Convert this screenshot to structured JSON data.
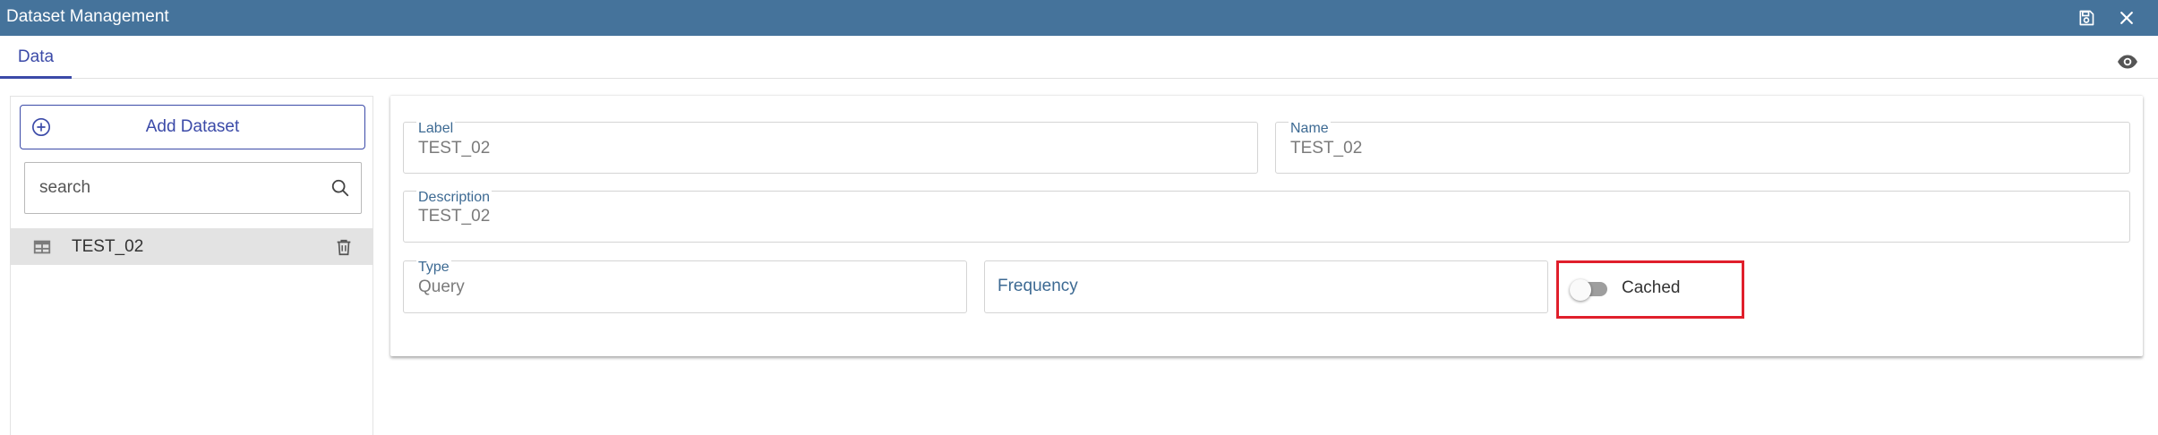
{
  "window": {
    "title": "Dataset Management",
    "save_icon": "floppy-disk-icon",
    "close_icon": "close-icon"
  },
  "tabs": [
    {
      "label": "Data",
      "active": true
    }
  ],
  "toolbar": {
    "preview_icon": "eye-icon"
  },
  "sidebar": {
    "add_button_label": "Add Dataset",
    "search_placeholder": "search",
    "items": [
      {
        "name": "TEST_02",
        "icon": "table-icon",
        "delete_icon": "trash-icon",
        "selected": true
      }
    ]
  },
  "form": {
    "label": {
      "label": "Label",
      "value": "TEST_02"
    },
    "name": {
      "label": "Name",
      "value": "TEST_02"
    },
    "description": {
      "label": "Description",
      "value": "TEST_02"
    },
    "type": {
      "label": "Type",
      "value": "Query"
    },
    "frequency": {
      "value": "Frequency"
    },
    "cached": {
      "label": "Cached",
      "enabled": false
    }
  },
  "colors": {
    "header": "#45739b",
    "accent": "#3b4aa8",
    "field_label": "#3d6a93",
    "highlight": "#e01f2b"
  }
}
